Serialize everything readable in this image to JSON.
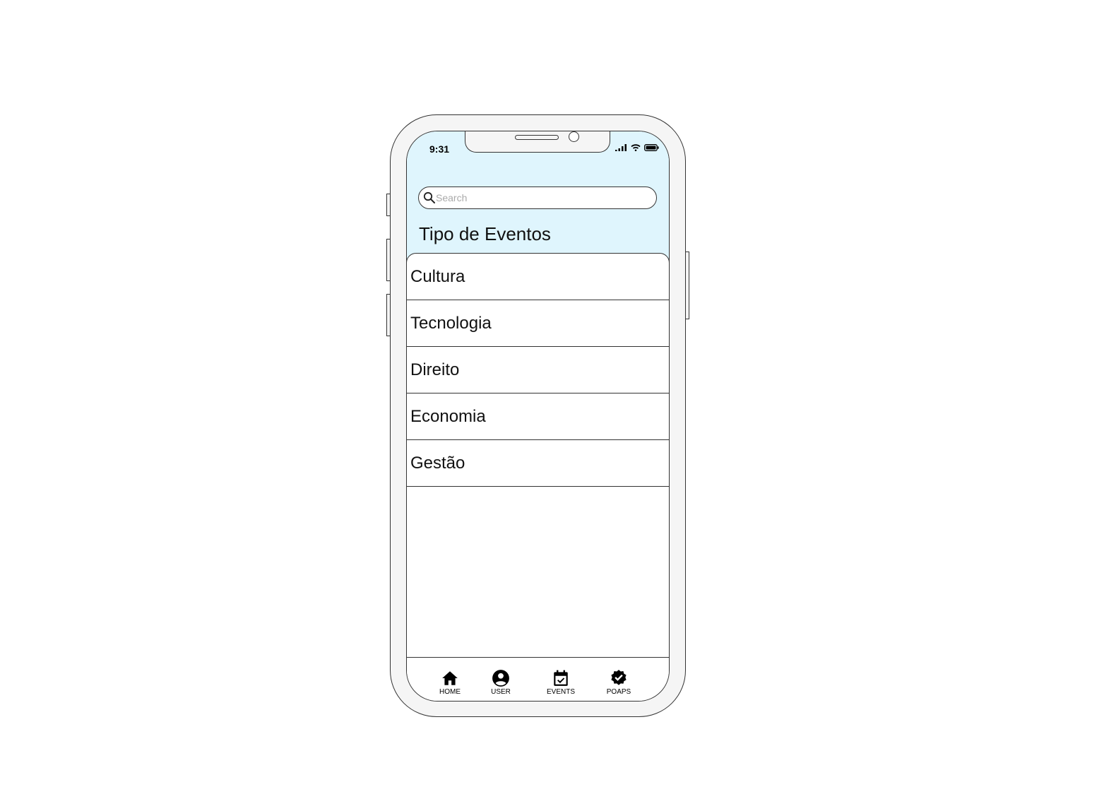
{
  "status_bar": {
    "time": "9:31"
  },
  "search": {
    "placeholder": "Search"
  },
  "page": {
    "title": "Tipo de Eventos"
  },
  "list": {
    "items": [
      {
        "label": "Cultura"
      },
      {
        "label": "Tecnologia"
      },
      {
        "label": "Direito"
      },
      {
        "label": "Economia"
      },
      {
        "label": "Gestão"
      }
    ]
  },
  "tabbar": {
    "tabs": [
      {
        "label": "HOME",
        "icon": "home-icon"
      },
      {
        "label": "USER",
        "icon": "user-icon"
      },
      {
        "label": "EVENTS",
        "icon": "calendar-check-icon"
      },
      {
        "label": "POAPS",
        "icon": "verified-badge-icon"
      }
    ]
  },
  "colors": {
    "header_bg": "#dff5fd",
    "frame": "#f5f5f5",
    "outline": "#333333"
  }
}
